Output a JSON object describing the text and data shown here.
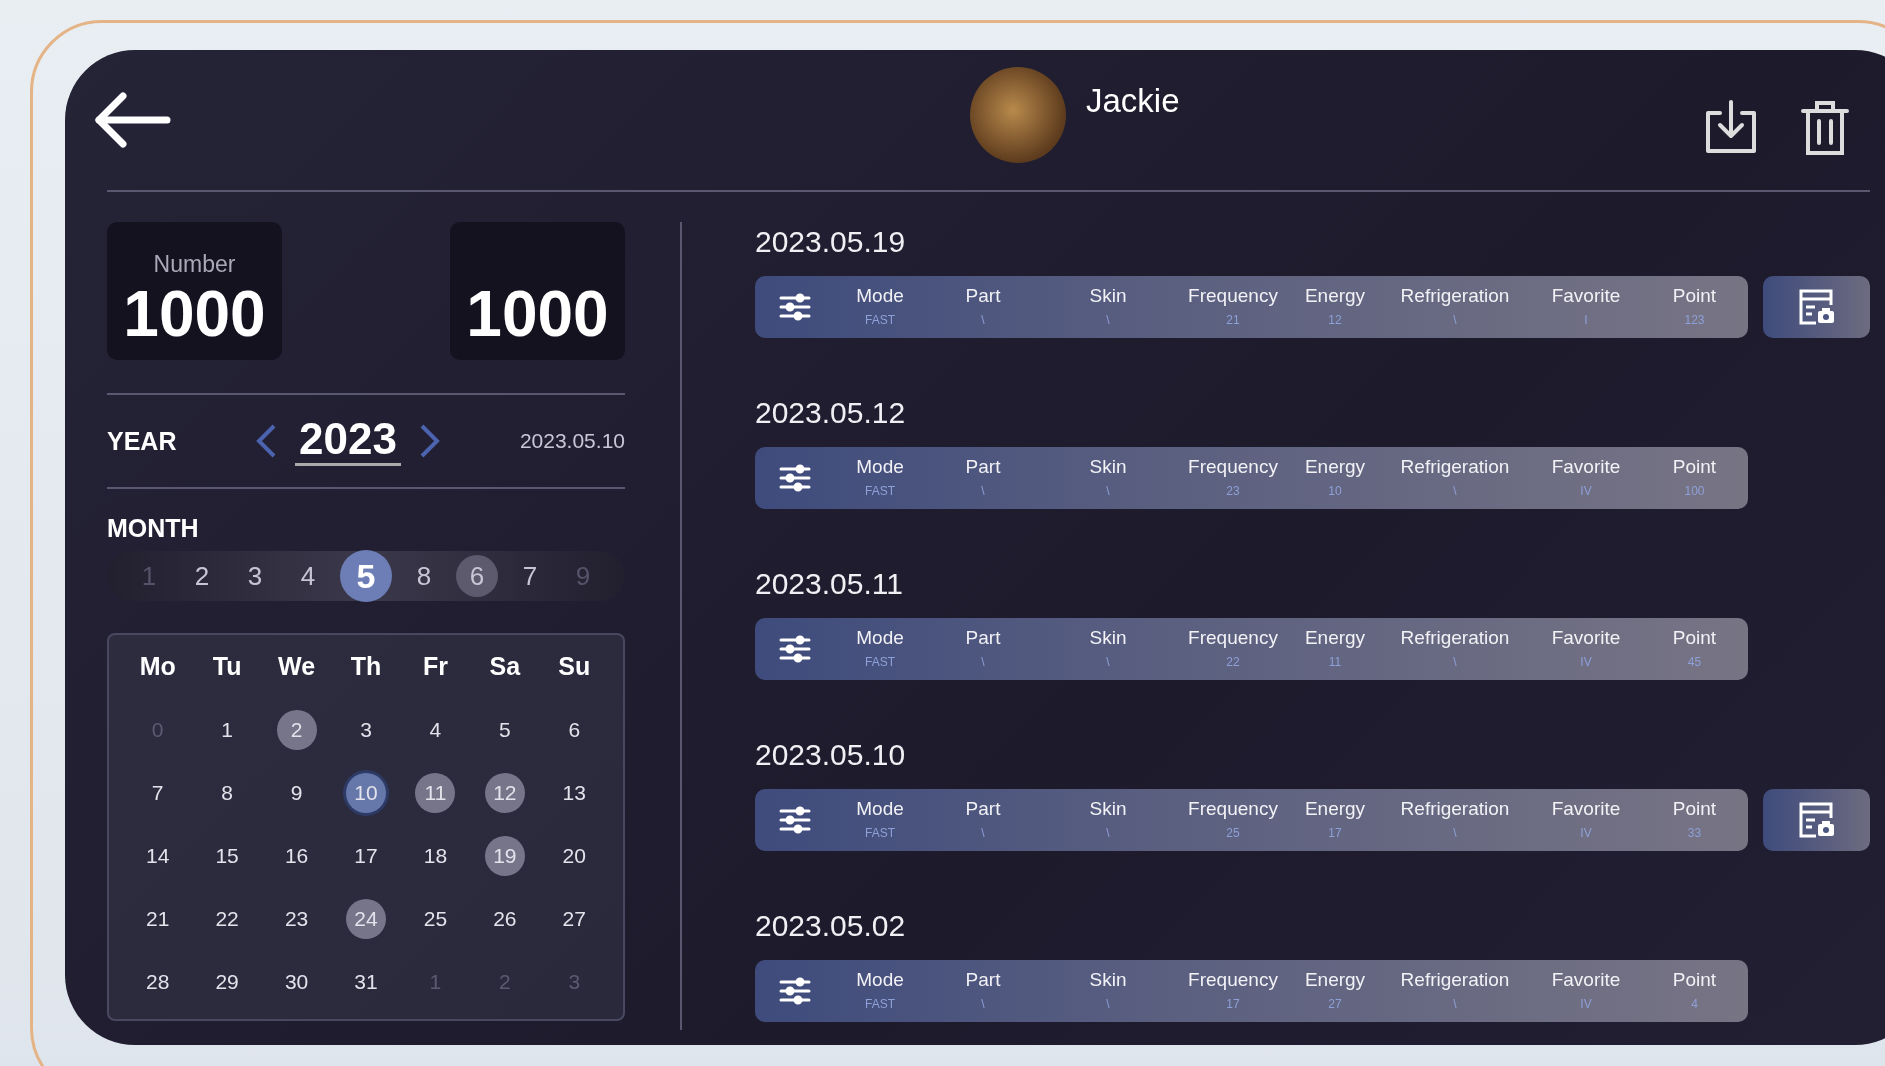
{
  "header": {
    "name": "Jackie"
  },
  "counters": [
    {
      "label": "Number",
      "value": "1000"
    },
    {
      "value": "1000"
    }
  ],
  "year": {
    "label": "YEAR",
    "value": "2023",
    "current_date": "2023.05.10"
  },
  "month": {
    "label": "MONTH",
    "items": [
      {
        "label": "1",
        "selected": false,
        "marked": false,
        "dim": true
      },
      {
        "label": "2",
        "selected": false,
        "marked": false,
        "dim": false
      },
      {
        "label": "3",
        "selected": false,
        "marked": false,
        "dim": false
      },
      {
        "label": "4",
        "selected": false,
        "marked": false,
        "dim": false
      },
      {
        "label": "5",
        "selected": true,
        "marked": false,
        "dim": false
      },
      {
        "label": "8",
        "selected": false,
        "marked": false,
        "dim": false
      },
      {
        "label": "6",
        "selected": false,
        "marked": true,
        "dim": false
      },
      {
        "label": "7",
        "selected": false,
        "marked": false,
        "dim": false
      },
      {
        "label": "9",
        "selected": false,
        "marked": false,
        "dim": true
      }
    ]
  },
  "calendar": {
    "weekdays": [
      "Mo",
      "Tu",
      "We",
      "Th",
      "Fr",
      "Sa",
      "Su"
    ],
    "days": [
      {
        "label": "0",
        "muted": true,
        "marked": false,
        "selected": false
      },
      {
        "label": "1",
        "muted": false,
        "marked": false,
        "selected": false
      },
      {
        "label": "2",
        "muted": false,
        "marked": true,
        "selected": false
      },
      {
        "label": "3",
        "muted": false,
        "marked": false,
        "selected": false
      },
      {
        "label": "4",
        "muted": false,
        "marked": false,
        "selected": false
      },
      {
        "label": "5",
        "muted": false,
        "marked": false,
        "selected": false
      },
      {
        "label": "6",
        "muted": false,
        "marked": false,
        "selected": false
      },
      {
        "label": "7",
        "muted": false,
        "marked": false,
        "selected": false
      },
      {
        "label": "8",
        "muted": false,
        "marked": false,
        "selected": false
      },
      {
        "label": "9",
        "muted": false,
        "marked": false,
        "selected": false
      },
      {
        "label": "10",
        "muted": false,
        "marked": false,
        "selected": true
      },
      {
        "label": "11",
        "muted": false,
        "marked": true,
        "selected": false
      },
      {
        "label": "12",
        "muted": false,
        "marked": true,
        "selected": false
      },
      {
        "label": "13",
        "muted": false,
        "marked": false,
        "selected": false
      },
      {
        "label": "14",
        "muted": false,
        "marked": false,
        "selected": false
      },
      {
        "label": "15",
        "muted": false,
        "marked": false,
        "selected": false
      },
      {
        "label": "16",
        "muted": false,
        "marked": false,
        "selected": false
      },
      {
        "label": "17",
        "muted": false,
        "marked": false,
        "selected": false
      },
      {
        "label": "18",
        "muted": false,
        "marked": false,
        "selected": false
      },
      {
        "label": "19",
        "muted": false,
        "marked": true,
        "selected": false
      },
      {
        "label": "20",
        "muted": false,
        "marked": false,
        "selected": false
      },
      {
        "label": "21",
        "muted": false,
        "marked": false,
        "selected": false
      },
      {
        "label": "22",
        "muted": false,
        "marked": false,
        "selected": false
      },
      {
        "label": "23",
        "muted": false,
        "marked": false,
        "selected": false
      },
      {
        "label": "24",
        "muted": false,
        "marked": true,
        "selected": false
      },
      {
        "label": "25",
        "muted": false,
        "marked": false,
        "selected": false
      },
      {
        "label": "26",
        "muted": false,
        "marked": false,
        "selected": false
      },
      {
        "label": "27",
        "muted": false,
        "marked": false,
        "selected": false
      },
      {
        "label": "28",
        "muted": false,
        "marked": false,
        "selected": false
      },
      {
        "label": "29",
        "muted": false,
        "marked": false,
        "selected": false
      },
      {
        "label": "30",
        "muted": false,
        "marked": false,
        "selected": false
      },
      {
        "label": "31",
        "muted": false,
        "marked": false,
        "selected": false
      },
      {
        "label": "1",
        "muted": true,
        "marked": false,
        "selected": false
      },
      {
        "label": "2",
        "muted": true,
        "marked": false,
        "selected": false
      },
      {
        "label": "3",
        "muted": true,
        "marked": false,
        "selected": false
      }
    ]
  },
  "records": [
    {
      "date": "2023.05.19",
      "has_report": true,
      "fields": [
        {
          "label": "Mode",
          "value": "FAST"
        },
        {
          "label": "Part",
          "value": "\\"
        },
        {
          "label": "Skin",
          "value": "\\"
        },
        {
          "label": "Frequency",
          "value": "21"
        },
        {
          "label": "Energy",
          "value": "12"
        },
        {
          "label": "Refrigeration",
          "value": "\\"
        },
        {
          "label": "Favorite",
          "value": "I"
        },
        {
          "label": "Point",
          "value": "123"
        }
      ]
    },
    {
      "date": "2023.05.12",
      "has_report": false,
      "fields": [
        {
          "label": "Mode",
          "value": "FAST"
        },
        {
          "label": "Part",
          "value": "\\"
        },
        {
          "label": "Skin",
          "value": "\\"
        },
        {
          "label": "Frequency",
          "value": "23"
        },
        {
          "label": "Energy",
          "value": "10"
        },
        {
          "label": "Refrigeration",
          "value": "\\"
        },
        {
          "label": "Favorite",
          "value": "IV"
        },
        {
          "label": "Point",
          "value": "100"
        }
      ]
    },
    {
      "date": "2023.05.11",
      "has_report": false,
      "fields": [
        {
          "label": "Mode",
          "value": "FAST"
        },
        {
          "label": "Part",
          "value": "\\"
        },
        {
          "label": "Skin",
          "value": "\\"
        },
        {
          "label": "Frequency",
          "value": "22"
        },
        {
          "label": "Energy",
          "value": "11"
        },
        {
          "label": "Refrigeration",
          "value": "\\"
        },
        {
          "label": "Favorite",
          "value": "IV"
        },
        {
          "label": "Point",
          "value": "45"
        }
      ]
    },
    {
      "date": "2023.05.10",
      "has_report": true,
      "fields": [
        {
          "label": "Mode",
          "value": "FAST"
        },
        {
          "label": "Part",
          "value": "\\"
        },
        {
          "label": "Skin",
          "value": "\\"
        },
        {
          "label": "Frequency",
          "value": "25"
        },
        {
          "label": "Energy",
          "value": "17"
        },
        {
          "label": "Refrigeration",
          "value": "\\"
        },
        {
          "label": "Favorite",
          "value": "IV"
        },
        {
          "label": "Point",
          "value": "33"
        }
      ]
    },
    {
      "date": "2023.05.02",
      "has_report": false,
      "fields": [
        {
          "label": "Mode",
          "value": "FAST"
        },
        {
          "label": "Part",
          "value": "\\"
        },
        {
          "label": "Skin",
          "value": "\\"
        },
        {
          "label": "Frequency",
          "value": "17"
        },
        {
          "label": "Energy",
          "value": "27"
        },
        {
          "label": "Refrigeration",
          "value": "\\"
        },
        {
          "label": "Favorite",
          "value": "IV"
        },
        {
          "label": "Point",
          "value": "4"
        }
      ]
    }
  ]
}
